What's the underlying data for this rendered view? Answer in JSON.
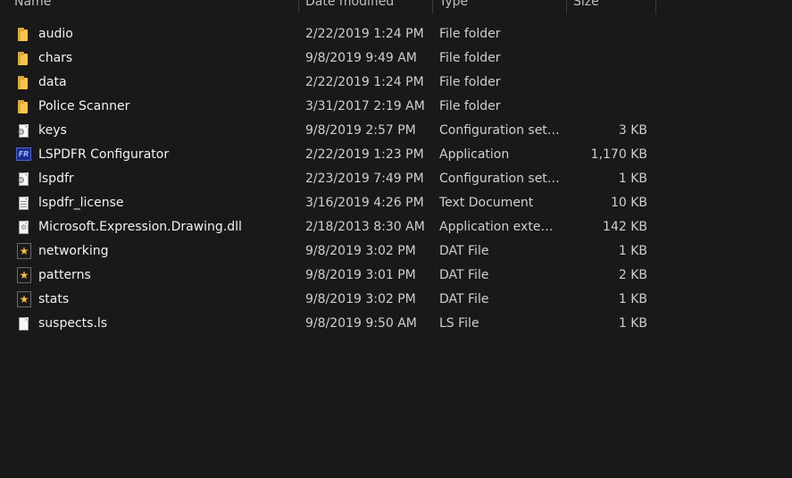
{
  "columns": {
    "name": "Name",
    "date": "Date modified",
    "type": "Type",
    "size": "Size"
  },
  "files": [
    {
      "name": "audio",
      "date": "2/22/2019 1:24 PM",
      "type": "File folder",
      "size": "",
      "icon": "folder-icon"
    },
    {
      "name": "chars",
      "date": "9/8/2019 9:49 AM",
      "type": "File folder",
      "size": "",
      "icon": "folder-icon"
    },
    {
      "name": "data",
      "date": "2/22/2019 1:24 PM",
      "type": "File folder",
      "size": "",
      "icon": "folder-icon"
    },
    {
      "name": "Police Scanner",
      "date": "3/31/2017 2:19 AM",
      "type": "File folder",
      "size": "",
      "icon": "folder-icon"
    },
    {
      "name": "keys",
      "date": "9/8/2019 2:57 PM",
      "type": "Configuration setti...",
      "size": "3 KB",
      "icon": "config-file-icon"
    },
    {
      "name": "LSPDFR Configurator",
      "date": "2/22/2019 1:23 PM",
      "type": "Application",
      "size": "1,170 KB",
      "icon": "application-icon"
    },
    {
      "name": "lspdfr",
      "date": "2/23/2019 7:49 PM",
      "type": "Configuration setti...",
      "size": "1 KB",
      "icon": "config-file-icon"
    },
    {
      "name": "lspdfr_license",
      "date": "3/16/2019 4:26 PM",
      "type": "Text Document",
      "size": "10 KB",
      "icon": "text-document-icon"
    },
    {
      "name": "Microsoft.Expression.Drawing.dll",
      "date": "2/18/2013 8:30 AM",
      "type": "Application extens...",
      "size": "142 KB",
      "icon": "dll-file-icon"
    },
    {
      "name": "networking",
      "date": "9/8/2019 3:02 PM",
      "type": "DAT File",
      "size": "1 KB",
      "icon": "dat-file-icon"
    },
    {
      "name": "patterns",
      "date": "9/8/2019 3:01 PM",
      "type": "DAT File",
      "size": "2 KB",
      "icon": "dat-file-icon"
    },
    {
      "name": "stats",
      "date": "9/8/2019 3:02 PM",
      "type": "DAT File",
      "size": "1 KB",
      "icon": "dat-file-icon"
    },
    {
      "name": "suspects.ls",
      "date": "9/8/2019 9:50 AM",
      "type": "LS File",
      "size": "1 KB",
      "icon": "blank-file-icon"
    }
  ],
  "app_icon_text": "FR",
  "colors": {
    "background": "#191919",
    "folder": "#f3c54c",
    "dat_star": "#f2c03a",
    "app_icon": "#1d2f8c"
  }
}
